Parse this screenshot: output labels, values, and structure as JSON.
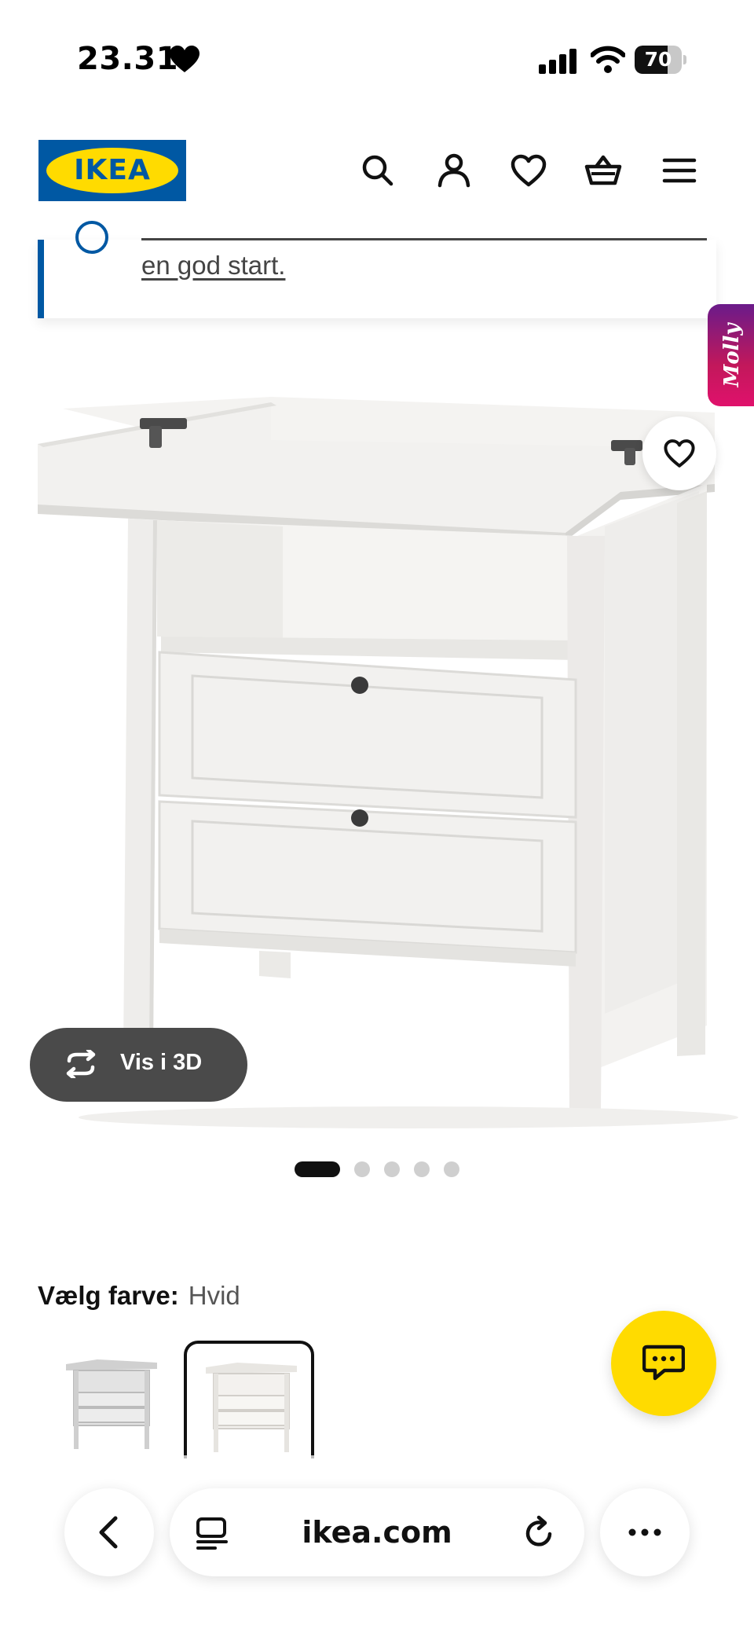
{
  "status_bar": {
    "time": "23.31",
    "battery_percent": "70",
    "battery_level": 0.7
  },
  "header": {
    "logo_text": "IKEA"
  },
  "notice": {
    "text": "en god start."
  },
  "molly": {
    "label": "Molly"
  },
  "gallery": {
    "view_3d_label": "Vis i 3D",
    "image_count": 5,
    "active_index": 0
  },
  "color": {
    "label": "Vælg farve:",
    "value": "Hvid"
  },
  "browser": {
    "url": "ikea.com"
  },
  "colors": {
    "ikea_blue": "#0058a3",
    "ikea_yellow": "#ffdb00",
    "dark_button": "#4a4a4a"
  }
}
